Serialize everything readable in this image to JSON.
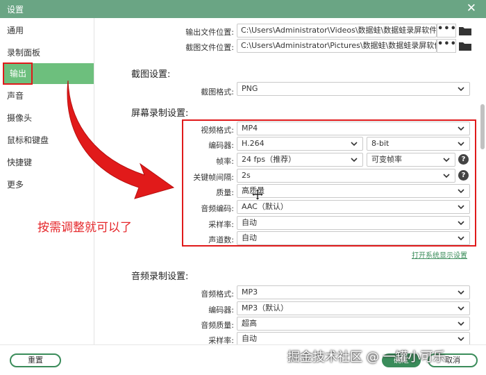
{
  "window": {
    "title": "设置",
    "close_glyph": "✕"
  },
  "sidebar": {
    "items": [
      {
        "label": "通用"
      },
      {
        "label": "录制面板"
      },
      {
        "label": "输出"
      },
      {
        "label": "声音"
      },
      {
        "label": "摄像头"
      },
      {
        "label": "鼠标和键盘"
      },
      {
        "label": "快捷键"
      },
      {
        "label": "更多"
      }
    ],
    "active_index": 2
  },
  "output": {
    "video_path_label": "输出文件位置:",
    "video_path": "C:\\Users\\Administrator\\Videos\\数据蛙\\数据蛙录屏软件",
    "shot_path_label": "截图文件位置:",
    "shot_path": "C:\\Users\\Administrator\\Pictures\\数据蛙\\数据蛙录屏软件",
    "browse_label": "•••"
  },
  "screenshot": {
    "title": "截图设置:",
    "format_label": "截图格式:",
    "format_value": "PNG"
  },
  "screen_rec": {
    "title": "屏幕录制设置:",
    "video_format_label": "视频格式:",
    "video_format": "MP4",
    "encoder_label": "编码器:",
    "encoder": "H.264",
    "bit_depth": "8-bit",
    "fps_label": "帧率:",
    "fps": "24 fps（推荐）",
    "fps_mode": "可变帧率",
    "keyframe_label": "关键帧间隔:",
    "keyframe": "2s",
    "quality_label": "质量:",
    "quality": "高质量",
    "audio_enc_label": "音频编码:",
    "audio_enc": "AAC（默认）",
    "sample_rate_label": "采样率:",
    "sample_rate": "自动",
    "channels_label": "声道数:",
    "channels": "自动",
    "help_glyph": "?",
    "display_settings_link": "打开系统显示设置"
  },
  "audio_rec": {
    "title": "音频录制设置:",
    "format_label": "音频格式:",
    "format": "MP3",
    "encoder_label": "编码器:",
    "encoder": "MP3（默认）",
    "quality_label": "音频质量:",
    "quality": "超高",
    "sample_rate_label": "采样率:",
    "sample_rate": "自动"
  },
  "annotation": {
    "text": "按需调整就可以了"
  },
  "footer": {
    "reset_label": "重置",
    "ok_label": "确定",
    "cancel_label": "取消"
  },
  "watermark": "掘金技术社区 @ 一罐小可乐",
  "colors": {
    "accent": "#3a8c5a",
    "sidebar_active": "#6dbf7d",
    "titlebar": "#6aa584",
    "highlight": "#e0191a"
  }
}
